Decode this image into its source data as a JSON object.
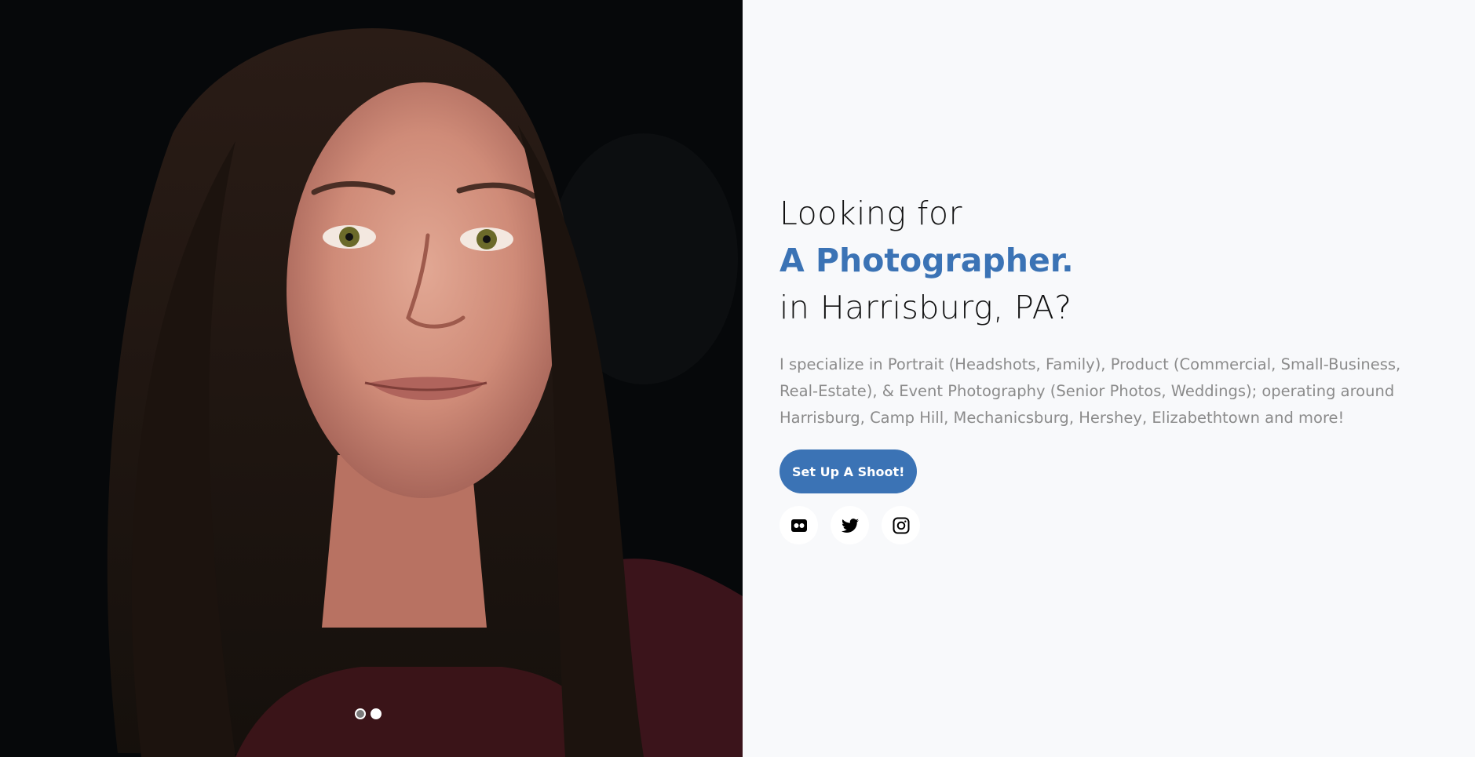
{
  "hero": {
    "image_description": "portrait of a smiling woman with long dark hair against a black background",
    "carousel_dots": [
      {
        "name": "slide-1",
        "active": false
      },
      {
        "name": "slide-2",
        "active": true
      }
    ]
  },
  "headline": {
    "line1": "Looking for",
    "accent": "A Photographer.",
    "line3": "in Harrisburg, PA?"
  },
  "description": "I specialize in Portrait (Headshots, Family), Product (Commercial, Small-Business, Real-Estate), & Event Photography (Senior Photos, Weddings); operating around Harrisburg, Camp Hill, Mechanicsburg, Hershey, Elizabethtown and more!",
  "cta": {
    "label": "Set Up A Shoot!"
  },
  "socials": [
    {
      "icon": "flickr-icon"
    },
    {
      "icon": "twitter-icon"
    },
    {
      "icon": "instagram-icon"
    }
  ],
  "colors": {
    "accent": "#3b73b5",
    "background": "#f8f9fb",
    "text_muted": "#8b8b8b"
  }
}
